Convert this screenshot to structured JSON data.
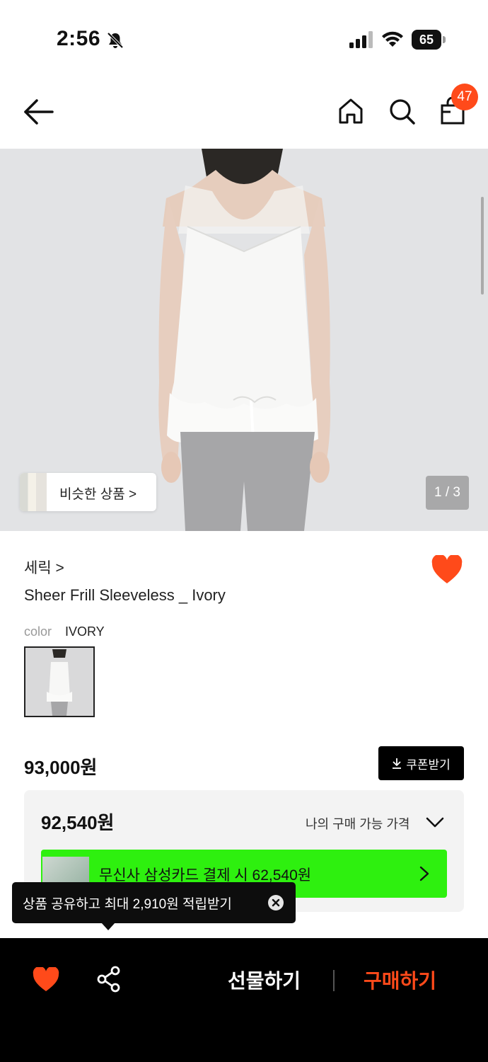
{
  "status_bar": {
    "time": "2:56",
    "battery": "65"
  },
  "nav": {
    "cart_count": "47"
  },
  "gallery": {
    "similar_label": "비슷한 상품 >",
    "page_indicator": "1 / 3"
  },
  "product": {
    "brand": "세릭 >",
    "name": "Sheer Frill Sleeveless _ Ivory",
    "color_label": "color",
    "color_value": "IVORY"
  },
  "pricing": {
    "price": "93,000원",
    "coupon_label": "쿠폰받기",
    "best_price": "92,540원",
    "my_price_label": "나의 구매 가능 가격",
    "card_promo": "무신사 삼성카드 결제 시 62,540원"
  },
  "tooltip": {
    "text": "상품 공유하고 최대 2,910원 적립받기"
  },
  "bottom_bar": {
    "gift_label": "선물하기",
    "buy_label": "구매하기"
  },
  "colors": {
    "accent": "#ff4a1a",
    "promo_green": "#2ef00f",
    "bar_bg": "#000000"
  },
  "icons": [
    "back-arrow-icon",
    "home-icon",
    "search-icon",
    "shopping-bag-icon",
    "heart-icon",
    "share-icon",
    "download-icon",
    "chevron-down-icon",
    "chevron-right-icon",
    "close-icon",
    "bell-slash-icon",
    "signal-icon",
    "wifi-icon",
    "battery-icon"
  ]
}
